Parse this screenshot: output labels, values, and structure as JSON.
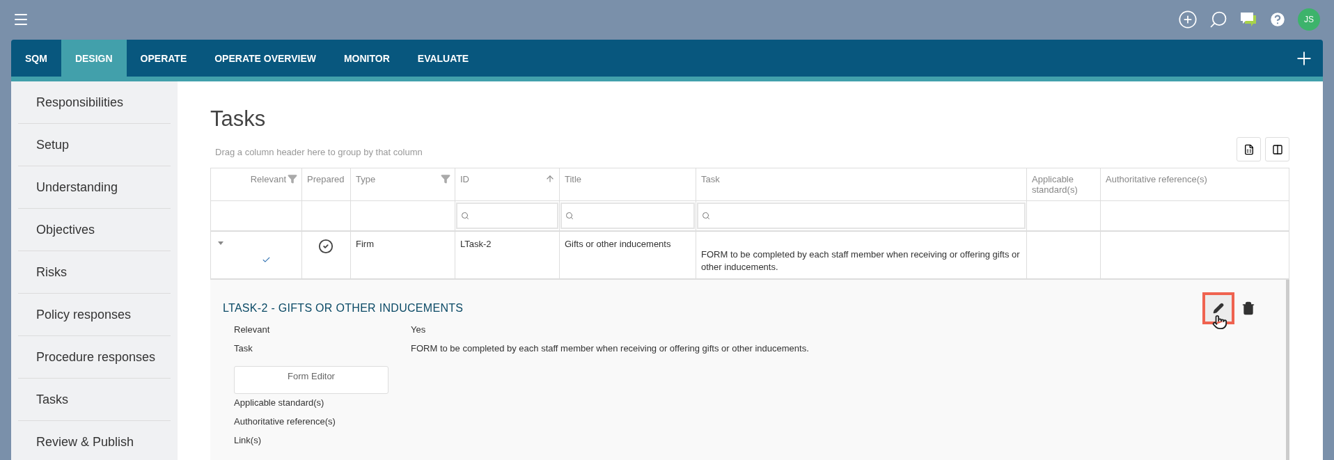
{
  "top_bar": {
    "avatar": "JS"
  },
  "nav_tabs": [
    {
      "label": "SQM",
      "selected": false
    },
    {
      "label": "DESIGN",
      "selected": true
    },
    {
      "label": "OPERATE",
      "selected": false
    },
    {
      "label": "OPERATE OVERVIEW",
      "selected": false
    },
    {
      "label": "MONITOR",
      "selected": false
    },
    {
      "label": "EVALUATE",
      "selected": false
    }
  ],
  "sidebar": {
    "items": [
      {
        "label": "Responsibilities",
        "selected": false
      },
      {
        "label": "Setup",
        "selected": false
      },
      {
        "label": "Understanding",
        "selected": false
      },
      {
        "label": "Objectives",
        "selected": false
      },
      {
        "label": "Risks",
        "selected": false
      },
      {
        "label": "Policy responses",
        "selected": false
      },
      {
        "label": "Procedure responses",
        "selected": false
      },
      {
        "label": "Tasks",
        "selected": false
      },
      {
        "label": "Review & Publish",
        "selected": false
      }
    ]
  },
  "page": {
    "title": "Tasks",
    "group_hint": "Drag a column header here to group by that column"
  },
  "table": {
    "columns": [
      {
        "label": "Relevant",
        "kind": "filter_right",
        "searchable": false
      },
      {
        "label": "Prepared",
        "kind": "plain",
        "searchable": false
      },
      {
        "label": "Type",
        "kind": "filter",
        "searchable": false
      },
      {
        "label": "ID",
        "kind": "sort_ascending",
        "searchable": true
      },
      {
        "label": "Title",
        "kind": "plain",
        "searchable": true
      },
      {
        "label": "Task",
        "kind": "plain",
        "searchable": true
      },
      {
        "label": "Applicable standard(s)",
        "kind": "plain",
        "searchable": false
      },
      {
        "label": "Authoritative reference(s)",
        "kind": "plain",
        "searchable": false
      }
    ],
    "rows": [
      {
        "expanded": true,
        "relevant": true,
        "prepared": true,
        "type": "Firm",
        "id": "LTask-2",
        "title": "Gifts or other inducements",
        "task": "FORM to be completed by each staff member when receiving or offering gifts or other inducements."
      }
    ]
  },
  "detail": {
    "heading": "LTASK-2 - GIFTS OR OTHER INDUCEMENTS",
    "edit_highlighted": true,
    "fields": [
      {
        "label": "Relevant",
        "value": "Yes"
      },
      {
        "label": "Task",
        "value": "FORM to be completed by each staff member when receiving or offering gifts or other inducements."
      }
    ],
    "form_button": "Form Editor",
    "more_labels": [
      "Applicable standard(s)",
      "Authoritative reference(s)",
      "Link(s)"
    ]
  }
}
